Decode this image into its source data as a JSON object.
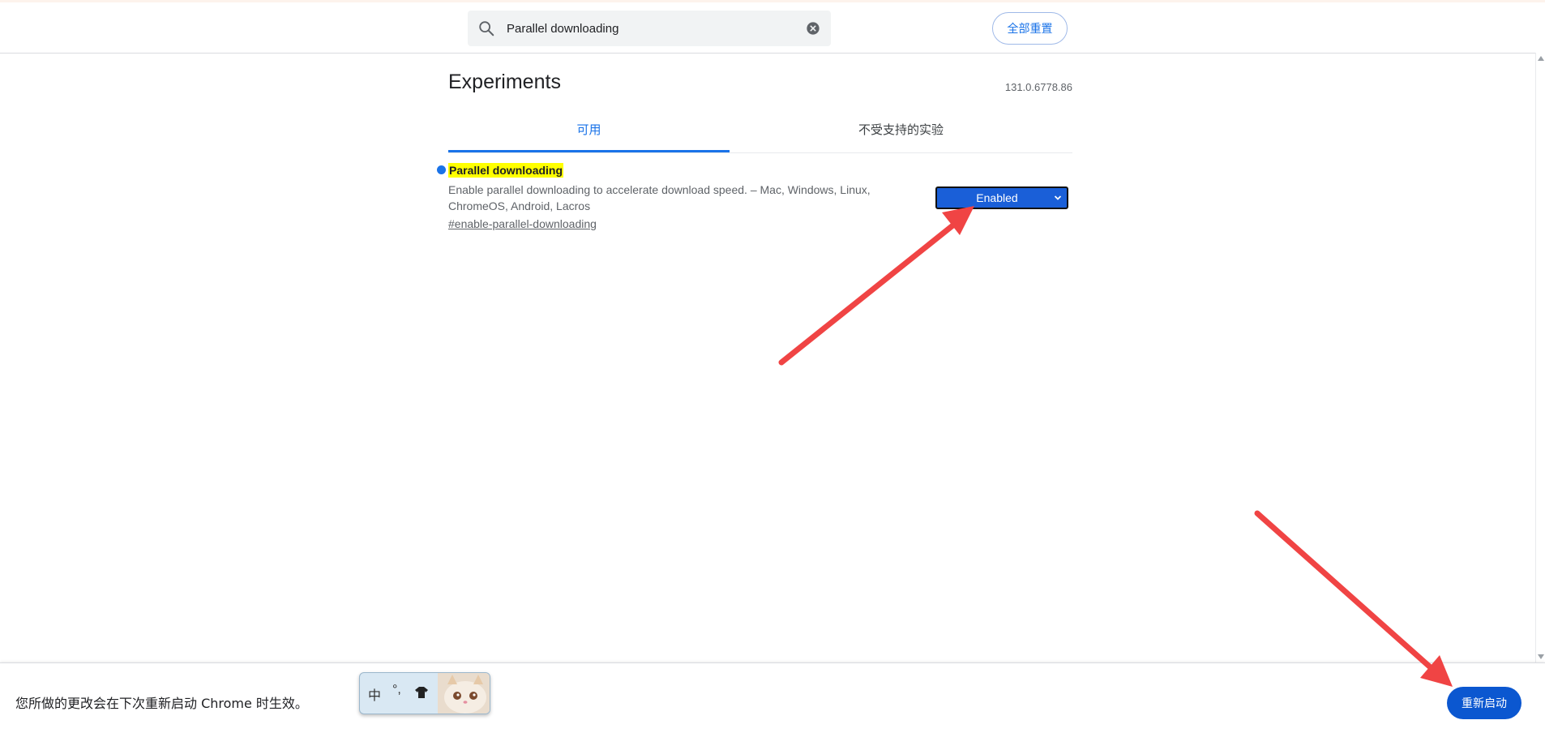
{
  "header": {
    "search": {
      "value": "Parallel downloading",
      "icon": "search-icon",
      "clear_icon": "clear-icon"
    },
    "reset_all_label": "全部重置"
  },
  "main": {
    "title": "Experiments",
    "version": "131.0.6778.86",
    "tabs": [
      {
        "label": "可用",
        "active": true
      },
      {
        "label": "不受支持的实验",
        "active": false
      }
    ],
    "flag": {
      "name": "Parallel downloading",
      "description": "Enable parallel downloading to accelerate download speed. – Mac, Windows, Linux, ChromeOS, Android, Lacros",
      "link": "#enable-parallel-downloading",
      "selected_value": "Enabled"
    }
  },
  "footer": {
    "message": "您所做的更改会在下次重新启动 Chrome 时生效。",
    "relaunch_label": "重新启动"
  },
  "ime_toolbar": {
    "mode": "中",
    "punctuation": "°,"
  },
  "colors": {
    "accent": "#1a73e8",
    "select_bg": "#1a5fd8",
    "relaunch_bg": "#0b57d0",
    "highlight": "#ffff00",
    "annotation_arrow": "#f04444"
  }
}
